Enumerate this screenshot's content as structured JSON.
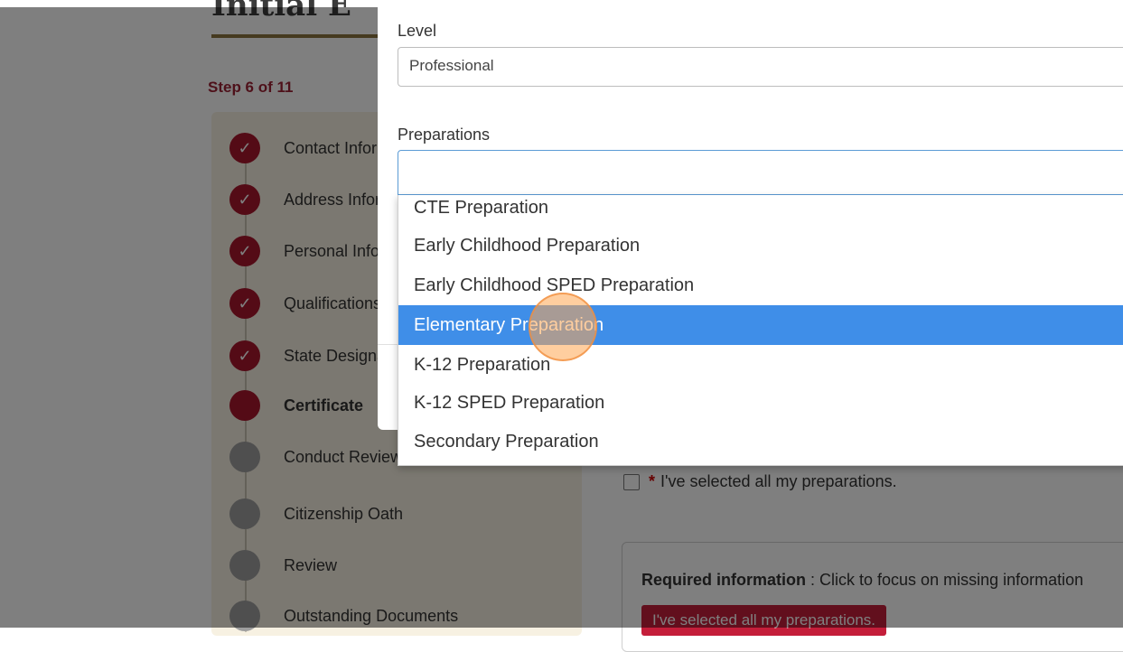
{
  "background": {
    "page_title": "Initial E",
    "step_label": "Step 6 of 11",
    "steps": [
      {
        "label": "Contact Information",
        "state": "done"
      },
      {
        "label": "Address Information",
        "state": "done"
      },
      {
        "label": "Personal Information",
        "state": "done"
      },
      {
        "label": "Qualifications",
        "state": "done"
      },
      {
        "label": "State Designations",
        "state": "done"
      },
      {
        "label": "Certificate",
        "state": "current"
      },
      {
        "label": "Conduct Review",
        "state": "todo"
      },
      {
        "label": "Citizenship Oath",
        "state": "todo"
      },
      {
        "label": "Review",
        "state": "todo"
      },
      {
        "label": "Outstanding Documents",
        "state": "todo"
      }
    ],
    "step_done_icon": "checkmark-icon",
    "acknowledgement": {
      "required_mark": "*",
      "label": "I've selected all my preparations."
    },
    "required_info": {
      "label": "Required information",
      "text": " : Click to focus on missing information"
    },
    "missing_badge": "I've selected all my preparations."
  },
  "modal": {
    "level_label": "Level",
    "level_value": "Professional",
    "preparations_label": "Preparations",
    "preparations_value": "",
    "options": [
      "CTE Preparation",
      "Early Childhood Preparation",
      "Early Childhood SPED Preparation",
      "Elementary Preparation",
      "K-12 Preparation",
      "K-12 SPED Preparation",
      "Secondary Preparation"
    ],
    "selected_option": "Elementary Preparation"
  },
  "colors": {
    "accent_red": "#a8162c",
    "selection_blue": "#3f8ee8",
    "click_highlight": "#ffa650"
  }
}
